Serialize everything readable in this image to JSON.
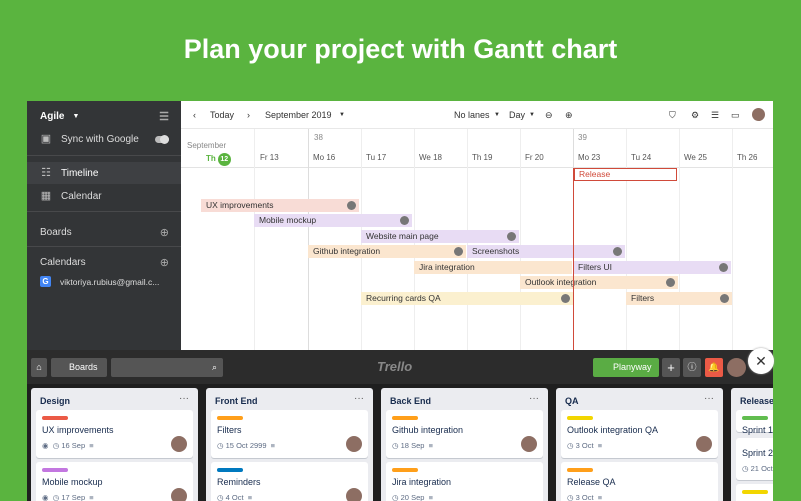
{
  "headline": "Plan your project with Gantt chart",
  "sidebar": {
    "workspace": "Agile",
    "sync": "Sync with Google",
    "timeline": "Timeline",
    "calendar": "Calendar",
    "boards": "Boards",
    "calendars": "Calendars",
    "account": "viktoriya.rubius@gmail.c..."
  },
  "gantt": {
    "today": "Today",
    "month": "September 2019",
    "lanes": "No lanes",
    "scale": "Day",
    "month_label": "September",
    "weeks": [
      "38",
      "39"
    ],
    "days": [
      "Th",
      "Fr 13",
      "Mo 16",
      "Tu 17",
      "We 18",
      "Th 19",
      "Fr 20",
      "Mo 23",
      "Tu 24",
      "We 25",
      "Th 26"
    ],
    "today_num": "12",
    "release": "Release",
    "bars": [
      {
        "label": "UX improvements",
        "color": "red"
      },
      {
        "label": "Mobile mockup",
        "color": "pur"
      },
      {
        "label": "Website main page",
        "color": "pur"
      },
      {
        "label": "Github integration",
        "color": "org"
      },
      {
        "label": "Screenshots",
        "color": "pur"
      },
      {
        "label": "Jira integration",
        "color": "org"
      },
      {
        "label": "Filters UI",
        "color": "pur"
      },
      {
        "label": "Outlook integration",
        "color": "org"
      },
      {
        "label": "Recurring cards QA",
        "color": "yel"
      },
      {
        "label": "Filters",
        "color": "org"
      }
    ]
  },
  "trello": {
    "boards": "Boards",
    "logo": "Trello",
    "planyway": "Planyway",
    "lists": [
      {
        "title": "Design",
        "cards": [
          {
            "title": "UX improvements",
            "meta": "16 Sep",
            "label": "#eb5a46"
          },
          {
            "title": "Mobile mockup",
            "meta": "17 Sep",
            "label": "#c377e0"
          }
        ]
      },
      {
        "title": "Front End",
        "cards": [
          {
            "title": "Filters",
            "meta": "15 Oct 2999",
            "label": "#ff9f1a"
          },
          {
            "title": "Reminders",
            "meta": "4 Oct",
            "label": "#0079bf"
          }
        ]
      },
      {
        "title": "Back End",
        "cards": [
          {
            "title": "Github integration",
            "meta": "18 Sep",
            "label": "#ff9f1a"
          },
          {
            "title": "Jira integration",
            "meta": "20 Sep",
            "label": "#ff9f1a"
          }
        ]
      },
      {
        "title": "QA",
        "cards": [
          {
            "title": "Outlook integration QA",
            "meta": "3 Oct",
            "label": "#f2d600"
          },
          {
            "title": "Release QA",
            "meta": "3 Oct",
            "label": "#ff9f1a"
          }
        ]
      },
      {
        "title": "Release",
        "cards": [
          {
            "title": "Sprint 1",
            "meta": "",
            "label": "#61bd4f"
          },
          {
            "title": "Sprint 2",
            "meta": "21 Oct",
            "label": "#f2d600"
          }
        ]
      }
    ]
  }
}
